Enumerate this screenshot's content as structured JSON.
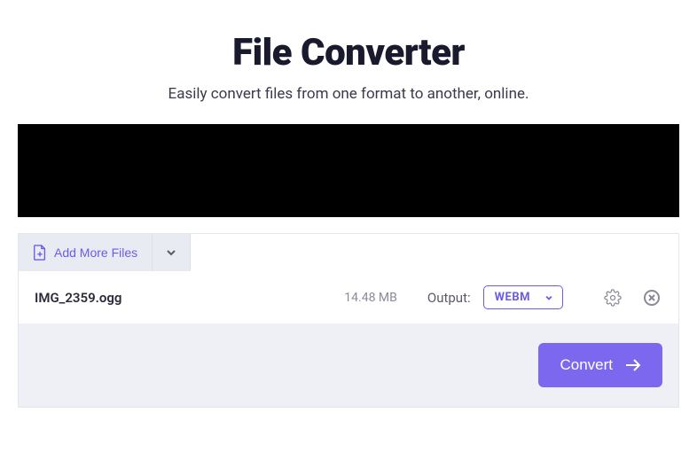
{
  "header": {
    "title": "File Converter",
    "subtitle": "Easily convert files from one format to another, online."
  },
  "toolbar": {
    "add_more_label": "Add More Files"
  },
  "file": {
    "name": "IMG_2359.ogg",
    "size": "14.48 MB",
    "output_label": "Output:",
    "format": "WEBM"
  },
  "actions": {
    "convert_label": "Convert"
  }
}
